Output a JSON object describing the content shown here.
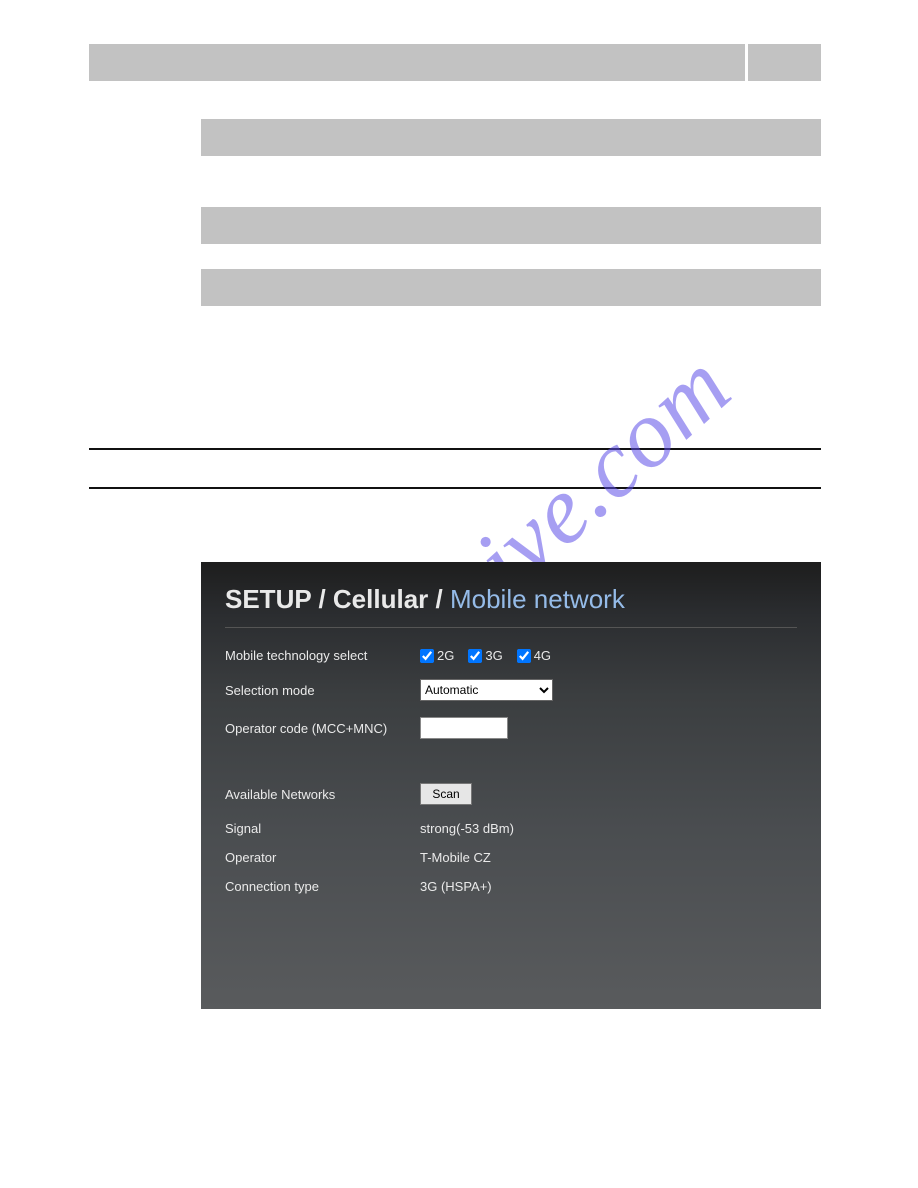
{
  "watermark": "manualshive.com",
  "panel": {
    "breadcrumb": {
      "a": "SETUP",
      "b": "Cellular",
      "c": "Mobile network"
    },
    "rows": {
      "tech_label": "Mobile technology select",
      "tech_opts": {
        "g2": "2G",
        "g3": "3G",
        "g4": "4G"
      },
      "selmode_label": "Selection mode",
      "selmode_value": "Automatic",
      "opcode_label": "Operator code (MCC+MNC)",
      "opcode_value": "",
      "avail_label": "Available Networks",
      "scan_label": "Scan",
      "signal_label": "Signal",
      "signal_value": "strong(-53 dBm)",
      "operator_label": "Operator",
      "operator_value": "T-Mobile CZ",
      "conn_label": "Connection type",
      "conn_value": "3G (HSPA+)"
    }
  }
}
